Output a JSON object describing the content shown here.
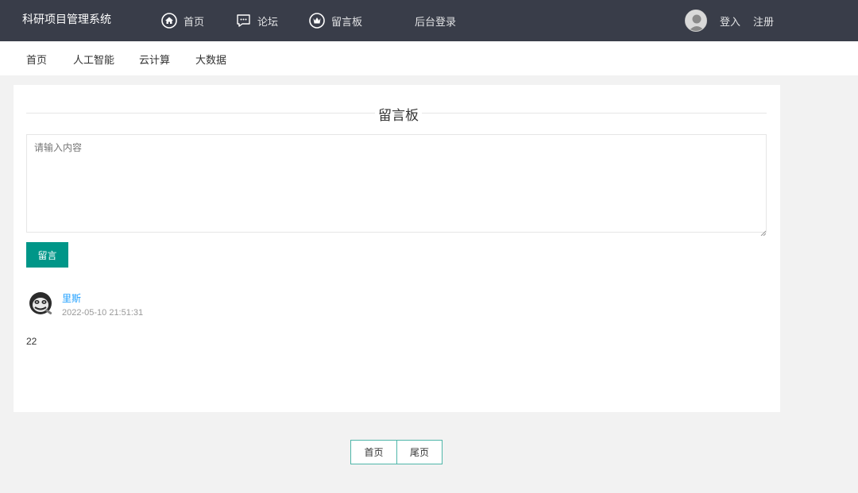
{
  "header": {
    "brand": "科研项目管理系统",
    "nav": [
      {
        "label": "首页",
        "icon": "home-icon"
      },
      {
        "label": "论坛",
        "icon": "chat-icon"
      },
      {
        "label": "留言板",
        "icon": "crown-icon"
      },
      {
        "label": "后台登录",
        "icon": ""
      }
    ],
    "login": "登入",
    "register": "注册"
  },
  "subnav": [
    "首页",
    "人工智能",
    "云计算",
    "大数据"
  ],
  "board": {
    "title": "留言板",
    "placeholder": "请输入内容",
    "submit": "留言"
  },
  "comments": [
    {
      "user": "里斯",
      "time": "2022-05-10 21:51:31",
      "content": "22",
      "avatar": "gorilla-avatar"
    }
  ],
  "pager": {
    "first": "首页",
    "last": "尾页"
  },
  "colors": {
    "header_bg": "#393d49",
    "accent": "#009688",
    "link": "#1e9fff"
  }
}
